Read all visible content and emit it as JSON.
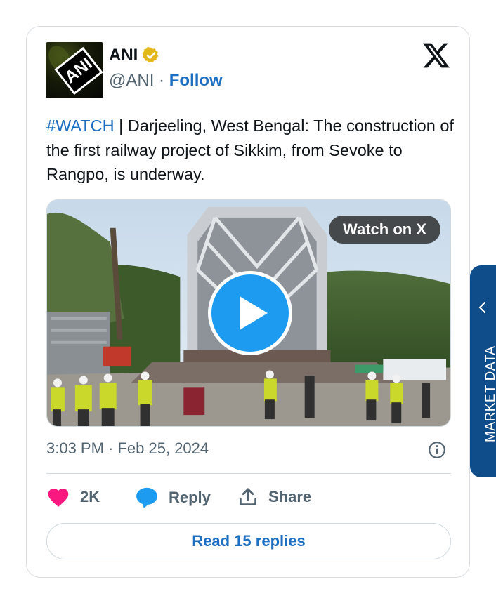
{
  "tweet": {
    "author": {
      "name": "ANI",
      "handle": "@ANI",
      "verified": true,
      "avatar_text": "ANI"
    },
    "separator": " · ",
    "follow_label": "Follow",
    "hashtag": "#WATCH",
    "text": " | Darjeeling, West Bengal: The construction of the first railway project of Sikkim, from Sevoke to Rangpo, is underway.",
    "media": {
      "watch_label": "Watch on X",
      "icon": "play-icon"
    },
    "timestamp": "3:03 PM · Feb 25, 2024",
    "actions": {
      "likes": "2K",
      "reply_label": "Reply",
      "share_label": "Share"
    },
    "read_replies_label": "Read 15 replies"
  },
  "side_tab": {
    "label": "MARKET DATA"
  },
  "colors": {
    "link": "#1d6fc2",
    "like": "#f91880",
    "reply": "#1d9bf0",
    "tab": "#0f4c8a",
    "verified": "#e2b719"
  }
}
